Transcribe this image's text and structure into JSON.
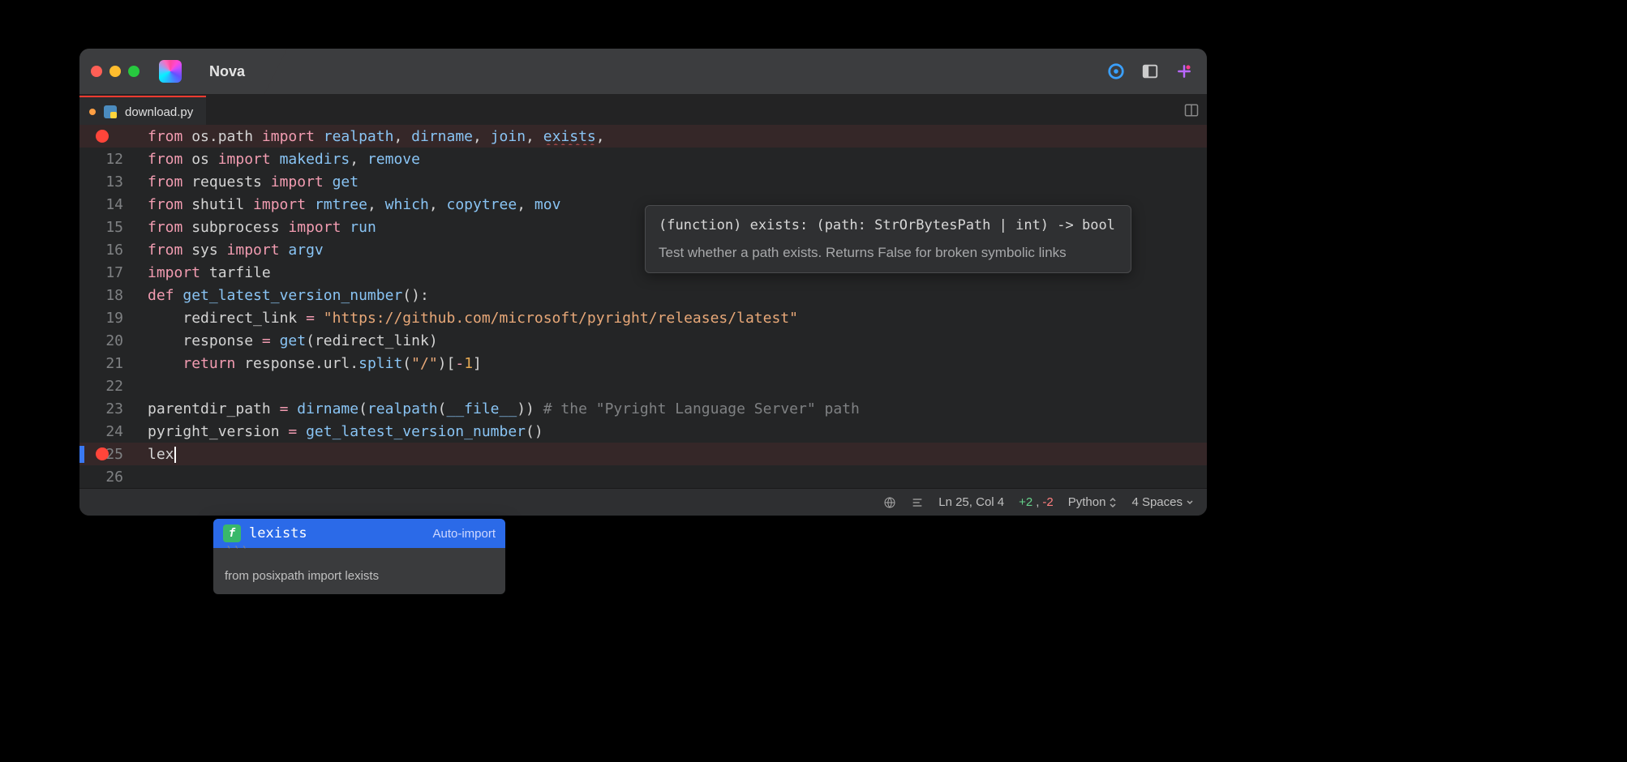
{
  "window": {
    "app_name": "Nova"
  },
  "tab": {
    "filename": "download.py",
    "dirty": true
  },
  "code": {
    "lines": [
      {
        "num": "",
        "err": true,
        "tokens": [
          {
            "t": "from ",
            "c": "kw"
          },
          {
            "t": "os.path ",
            "c": "id"
          },
          {
            "t": "import ",
            "c": "kw"
          },
          {
            "t": "realpath",
            "c": "fn"
          },
          {
            "t": ", ",
            "c": "id"
          },
          {
            "t": "dirname",
            "c": "fn"
          },
          {
            "t": ", ",
            "c": "id"
          },
          {
            "t": "join",
            "c": "fn"
          },
          {
            "t": ", ",
            "c": "id"
          },
          {
            "t": "exists",
            "c": "fn squiggle"
          },
          {
            "t": ",",
            "c": "id"
          }
        ]
      },
      {
        "num": "12",
        "tokens": [
          {
            "t": "from ",
            "c": "kw"
          },
          {
            "t": "os ",
            "c": "id"
          },
          {
            "t": "import ",
            "c": "kw"
          },
          {
            "t": "makedirs",
            "c": "fn"
          },
          {
            "t": ", ",
            "c": "id"
          },
          {
            "t": "remove",
            "c": "fn"
          }
        ]
      },
      {
        "num": "13",
        "tokens": [
          {
            "t": "from ",
            "c": "kw"
          },
          {
            "t": "requests ",
            "c": "id"
          },
          {
            "t": "import ",
            "c": "kw"
          },
          {
            "t": "get",
            "c": "fn"
          }
        ]
      },
      {
        "num": "14",
        "tokens": [
          {
            "t": "from ",
            "c": "kw"
          },
          {
            "t": "shutil ",
            "c": "id"
          },
          {
            "t": "import ",
            "c": "kw"
          },
          {
            "t": "rmtree",
            "c": "fn"
          },
          {
            "t": ", ",
            "c": "id"
          },
          {
            "t": "which",
            "c": "fn"
          },
          {
            "t": ", ",
            "c": "id"
          },
          {
            "t": "copytree",
            "c": "fn"
          },
          {
            "t": ", ",
            "c": "id"
          },
          {
            "t": "mov",
            "c": "fn"
          }
        ]
      },
      {
        "num": "15",
        "tokens": [
          {
            "t": "from ",
            "c": "kw"
          },
          {
            "t": "subprocess ",
            "c": "id"
          },
          {
            "t": "import ",
            "c": "kw"
          },
          {
            "t": "run",
            "c": "fn"
          }
        ]
      },
      {
        "num": "16",
        "tokens": [
          {
            "t": "from ",
            "c": "kw"
          },
          {
            "t": "sys ",
            "c": "id"
          },
          {
            "t": "import ",
            "c": "kw"
          },
          {
            "t": "argv",
            "c": "fn"
          }
        ]
      },
      {
        "num": "17",
        "tokens": [
          {
            "t": "import ",
            "c": "kw"
          },
          {
            "t": "tarfile",
            "c": "id"
          }
        ]
      },
      {
        "num": "18",
        "fold": true,
        "tokens": [
          {
            "t": "def ",
            "c": "kw"
          },
          {
            "t": "get_latest_version_number",
            "c": "fn"
          },
          {
            "t": "():",
            "c": "id"
          }
        ]
      },
      {
        "num": "19",
        "fold": true,
        "indent": 1,
        "tokens": [
          {
            "t": "redirect_link ",
            "c": "id"
          },
          {
            "t": "= ",
            "c": "op"
          },
          {
            "t": "\"https://github.com/microsoft/pyright/releases/latest\"",
            "c": "str"
          }
        ]
      },
      {
        "num": "20",
        "fold": true,
        "indent": 1,
        "tokens": [
          {
            "t": "response ",
            "c": "id"
          },
          {
            "t": "= ",
            "c": "op"
          },
          {
            "t": "get",
            "c": "fn"
          },
          {
            "t": "(redirect_link)",
            "c": "id"
          }
        ]
      },
      {
        "num": "21",
        "fold": true,
        "indent": 1,
        "tokens": [
          {
            "t": "return ",
            "c": "kw"
          },
          {
            "t": "response.url.",
            "c": "id"
          },
          {
            "t": "split",
            "c": "fn"
          },
          {
            "t": "(",
            "c": "id"
          },
          {
            "t": "\"/\"",
            "c": "str"
          },
          {
            "t": ")[",
            "c": "id"
          },
          {
            "t": "-",
            "c": "op"
          },
          {
            "t": "1",
            "c": "num"
          },
          {
            "t": "]",
            "c": "id"
          }
        ]
      },
      {
        "num": "22",
        "tokens": []
      },
      {
        "num": "23",
        "tokens": [
          {
            "t": "parentdir_path ",
            "c": "id"
          },
          {
            "t": "= ",
            "c": "op"
          },
          {
            "t": "dirname",
            "c": "fn"
          },
          {
            "t": "(",
            "c": "id"
          },
          {
            "t": "realpath",
            "c": "fn"
          },
          {
            "t": "(",
            "c": "id"
          },
          {
            "t": "__file__",
            "c": "fn"
          },
          {
            "t": ")) ",
            "c": "id"
          },
          {
            "t": "# the \"Pyright Language Server\" path",
            "c": "cm"
          }
        ]
      },
      {
        "num": "24",
        "tokens": [
          {
            "t": "pyright_version ",
            "c": "id"
          },
          {
            "t": "= ",
            "c": "op"
          },
          {
            "t": "get_latest_version_number",
            "c": "fn"
          },
          {
            "t": "()",
            "c": "id"
          }
        ]
      },
      {
        "num": "25",
        "err": true,
        "cursor": true,
        "tokens": [
          {
            "t": "lex",
            "c": "id"
          }
        ]
      },
      {
        "num": "26",
        "tokens": []
      }
    ]
  },
  "tooltip": {
    "signature": "(function) exists: (path: StrOrBytesPath | int) -> bool",
    "doc": "Test whether a path exists. Returns False for broken symbolic links"
  },
  "autocomplete": {
    "items": [
      {
        "label": "lexists",
        "action": "Auto-import",
        "selected": true
      }
    ],
    "detail": "from posixpath import lexists"
  },
  "statusbar": {
    "position": "Ln 25, Col 4",
    "diff_add": "+2",
    "diff_del": "-2",
    "language": "Python",
    "indent": "4 Spaces"
  }
}
